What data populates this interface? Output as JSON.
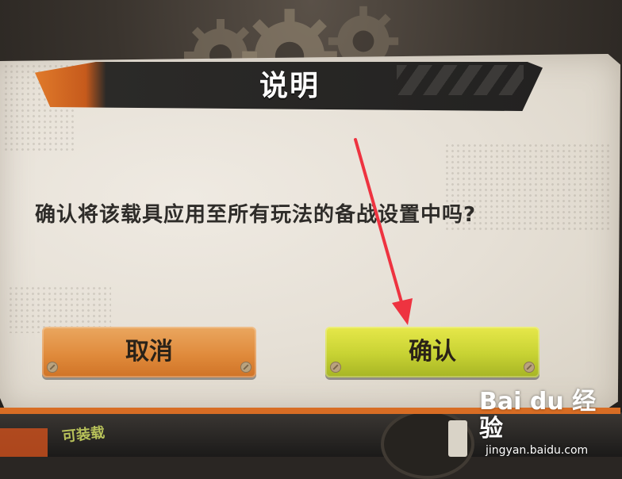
{
  "dialog": {
    "title": "说明",
    "message": "确认将该载具应用至所有玩法的备战设置中吗?",
    "cancel_label": "取消",
    "confirm_label": "确认"
  },
  "background": {
    "equip_label": "可装载"
  },
  "watermark": {
    "logo": "Bai du 经验",
    "url": "jingyan.baidu.com"
  },
  "colors": {
    "cancel_button": "#e08b3c",
    "confirm_button": "#c7d233",
    "annotation_arrow": "#ee3340",
    "title_accent": "#e07a2b"
  },
  "icons": {
    "bolt": "bolt-icon",
    "gear": "gear-icon",
    "annotation": "red-arrow-annotation"
  }
}
